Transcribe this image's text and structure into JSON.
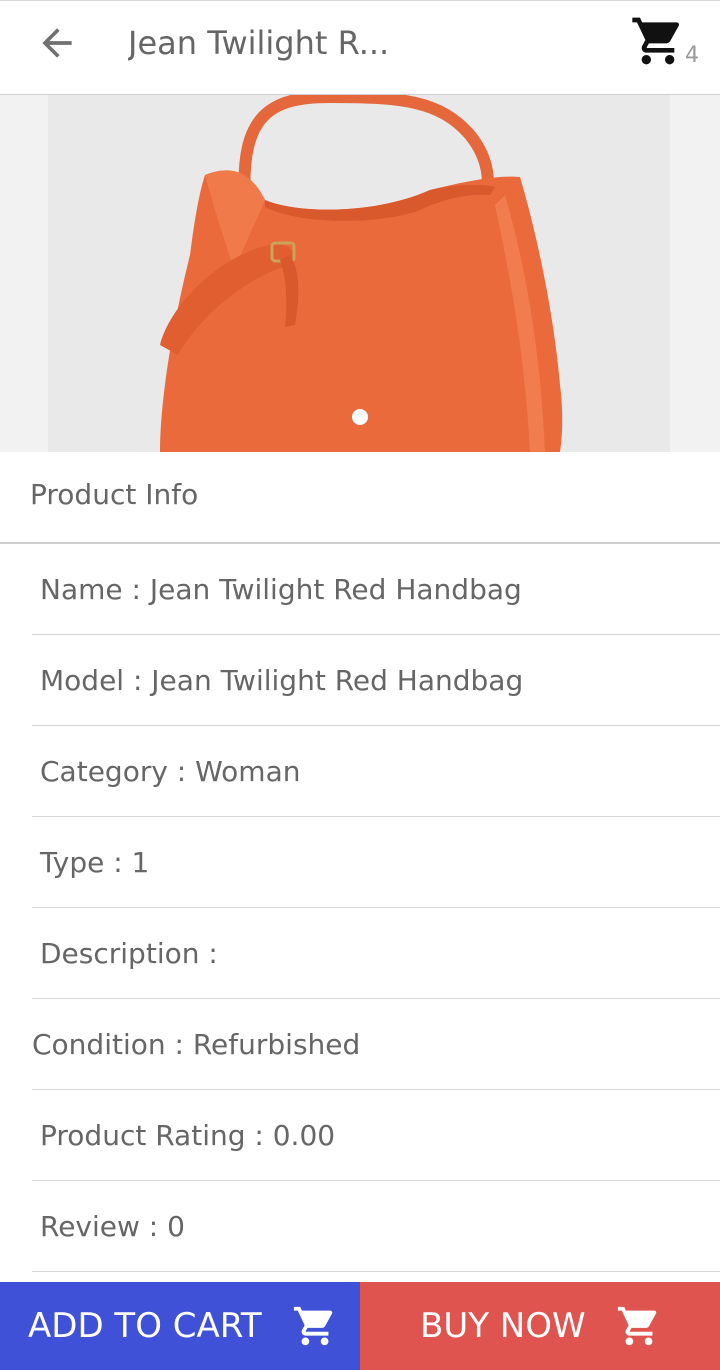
{
  "header": {
    "title": "Jean Twilight R...",
    "cart_count": "4"
  },
  "gallery": {
    "page_count": 1,
    "active_page": 1
  },
  "section": {
    "title": "Product Info"
  },
  "info": [
    {
      "label": "Name : Jean Twilight Red Handbag"
    },
    {
      "label": "Model : Jean Twilight Red Handbag"
    },
    {
      "label": "Category : Woman"
    },
    {
      "label": "Type : 1"
    },
    {
      "label": "Description :"
    },
    {
      "label": "Condition : Refurbished"
    },
    {
      "label": "Product Rating : 0.00"
    },
    {
      "label": "Review : 0"
    }
  ],
  "actions": {
    "add_to_cart": "ADD TO CART",
    "buy_now": "BUY NOW"
  },
  "icons": {
    "back": "arrow-left-icon",
    "cart": "shopping-cart-icon"
  },
  "colors": {
    "add_to_cart_bg": "#3f51d7",
    "buy_now_bg": "#e0544f",
    "product_orange": "#ea6a3b"
  }
}
